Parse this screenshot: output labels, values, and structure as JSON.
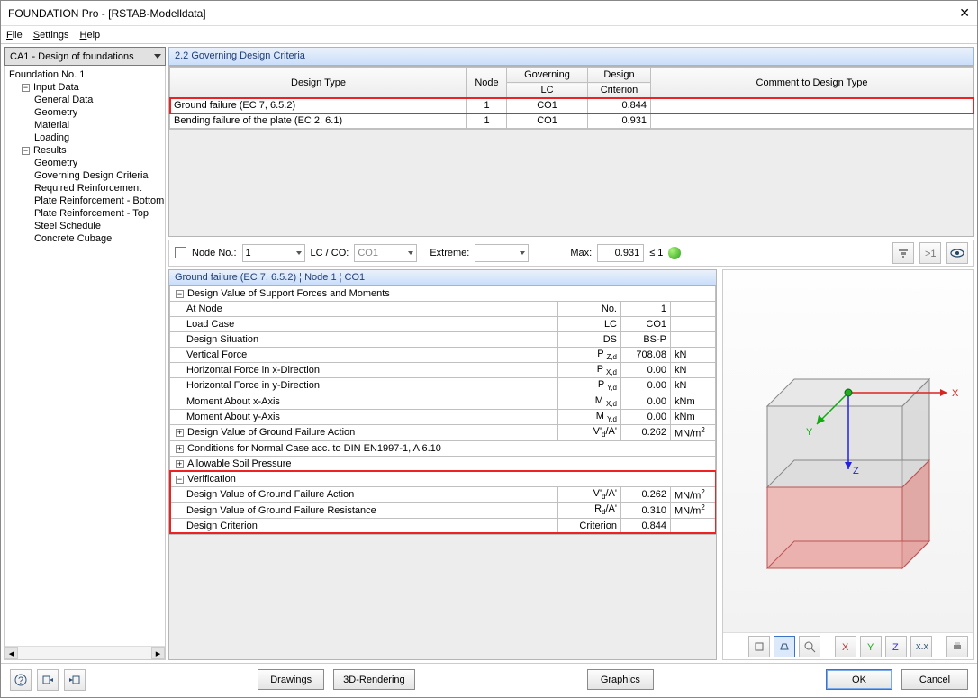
{
  "window": {
    "title": "FOUNDATION Pro - [RSTAB-Modelldata]"
  },
  "menu": {
    "file": "File",
    "settings": "Settings",
    "help": "Help"
  },
  "combo": {
    "value": "CA1 - Design of foundations"
  },
  "section": {
    "title": "2.2 Governing Design Criteria"
  },
  "tree": {
    "root": "Foundation No. 1",
    "input": "Input Data",
    "input_items": [
      "General Data",
      "Geometry",
      "Material",
      "Loading"
    ],
    "results": "Results",
    "results_items": [
      "Geometry",
      "Governing Design Criteria",
      "Required Reinforcement",
      "Plate Reinforcement - Bottom",
      "Plate Reinforcement - Top",
      "Steel Schedule",
      "Concrete Cubage"
    ]
  },
  "grid": {
    "headers": {
      "c0": "Design Type",
      "c1": "Node",
      "c2g": "Governing",
      "c2": "LC",
      "c3g": "Design",
      "c3": "Criterion",
      "c4": "Comment to Design Type"
    },
    "rows": [
      {
        "type": "Ground failure (EC 7, 6.5.2)",
        "node": "1",
        "lc": "CO1",
        "crit": "0.844",
        "comment": "",
        "hl": true
      },
      {
        "type": "Bending failure of the plate (EC 2, 6.1)",
        "node": "1",
        "lc": "CO1",
        "crit": "0.931",
        "comment": "",
        "hl": false
      }
    ]
  },
  "filter": {
    "node_label": "Node No.:",
    "node_val": "1",
    "lcco_label": "LC / CO:",
    "lcco_val": "CO1",
    "extreme_label": "Extreme:",
    "extreme_val": "",
    "max_label": "Max:",
    "max_val": "0.931",
    "max_cmp": "≤ 1"
  },
  "detail": {
    "title": "Ground failure (EC 7, 6.5.2) ¦ Node 1 ¦ CO1",
    "g1": "Design Value of Support Forces and Moments",
    "r": [
      {
        "l": "At Node",
        "s": "No.",
        "v": "1",
        "u": ""
      },
      {
        "l": "Load Case",
        "s": "LC",
        "v": "CO1",
        "u": ""
      },
      {
        "l": "Design Situation",
        "s": "DS",
        "v": "BS-P",
        "u": ""
      },
      {
        "l": "Vertical Force",
        "s": "P Z,d",
        "v": "708.08",
        "u": "kN"
      },
      {
        "l": "Horizontal Force in x-Direction",
        "s": "P X,d",
        "v": "0.00",
        "u": "kN"
      },
      {
        "l": "Horizontal Force in y-Direction",
        "s": "P Y,d",
        "v": "0.00",
        "u": "kN"
      },
      {
        "l": "Moment About x-Axis",
        "s": "M X,d",
        "v": "0.00",
        "u": "kNm"
      },
      {
        "l": "Moment About y-Axis",
        "s": "M Y,d",
        "v": "0.00",
        "u": "kNm"
      }
    ],
    "g2": "Design Value of Ground Failure Action",
    "g2r": {
      "s": "V'd/A'",
      "v": "0.262",
      "u": "MN/m²"
    },
    "g3": "Conditions for Normal Case acc. to DIN EN1997-1, A 6.10",
    "g4": "Allowable Soil Pressure",
    "g5": "Verification",
    "vr": [
      {
        "l": "Design Value of Ground Failure Action",
        "s": "V'd/A'",
        "v": "0.262",
        "u": "MN/m²"
      },
      {
        "l": "Design Value of Ground Failure Resistance",
        "s": "Rd/A'",
        "v": "0.310",
        "u": "MN/m²"
      },
      {
        "l": "Design Criterion",
        "s": "Criterion",
        "v": "0.844",
        "u": ""
      }
    ]
  },
  "footer": {
    "drawings": "Drawings",
    "render": "3D-Rendering",
    "graphics": "Graphics",
    "ok": "OK",
    "cancel": "Cancel"
  },
  "axis": {
    "x": "X",
    "y": "Y",
    "z": "Z"
  }
}
